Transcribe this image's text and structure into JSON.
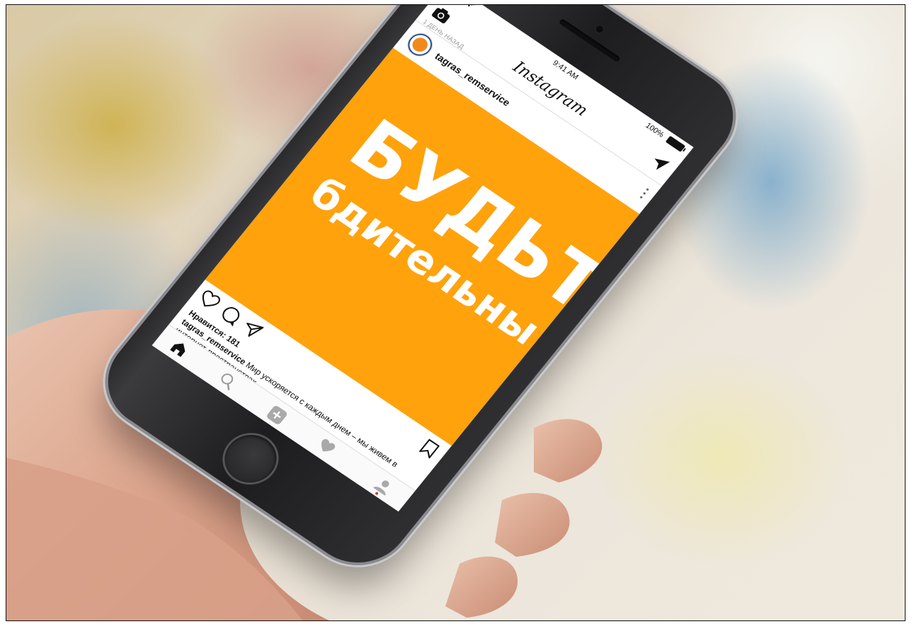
{
  "status_bar": {
    "signal": "•••••",
    "time": "9:41 AM",
    "battery": "100%"
  },
  "app": {
    "logo": "Instagram"
  },
  "post": {
    "time_ago": "1 ДЕНЬ НАЗАД",
    "username": "tagras_remservice",
    "image_headline": "БУДЬТЕ",
    "image_subline": "бдительны!",
    "image_background": "#ffa20c",
    "likes": "Нравится: 181",
    "caption_user": "tagras_remservice",
    "caption_text": "Мир ускоряется с каждым днем – мы живем в интернет-пространствах..."
  },
  "colors": {
    "accent": "#ffa20c",
    "notification_dot": "#e0332b"
  },
  "icons": {
    "topbar": [
      "camera-icon",
      "send-icon"
    ],
    "actions": [
      "heart-icon",
      "comment-icon",
      "share-icon",
      "bookmark-icon"
    ],
    "tabbar": [
      "home-icon",
      "search-icon",
      "add-icon",
      "activity-heart-icon",
      "profile-icon"
    ]
  }
}
